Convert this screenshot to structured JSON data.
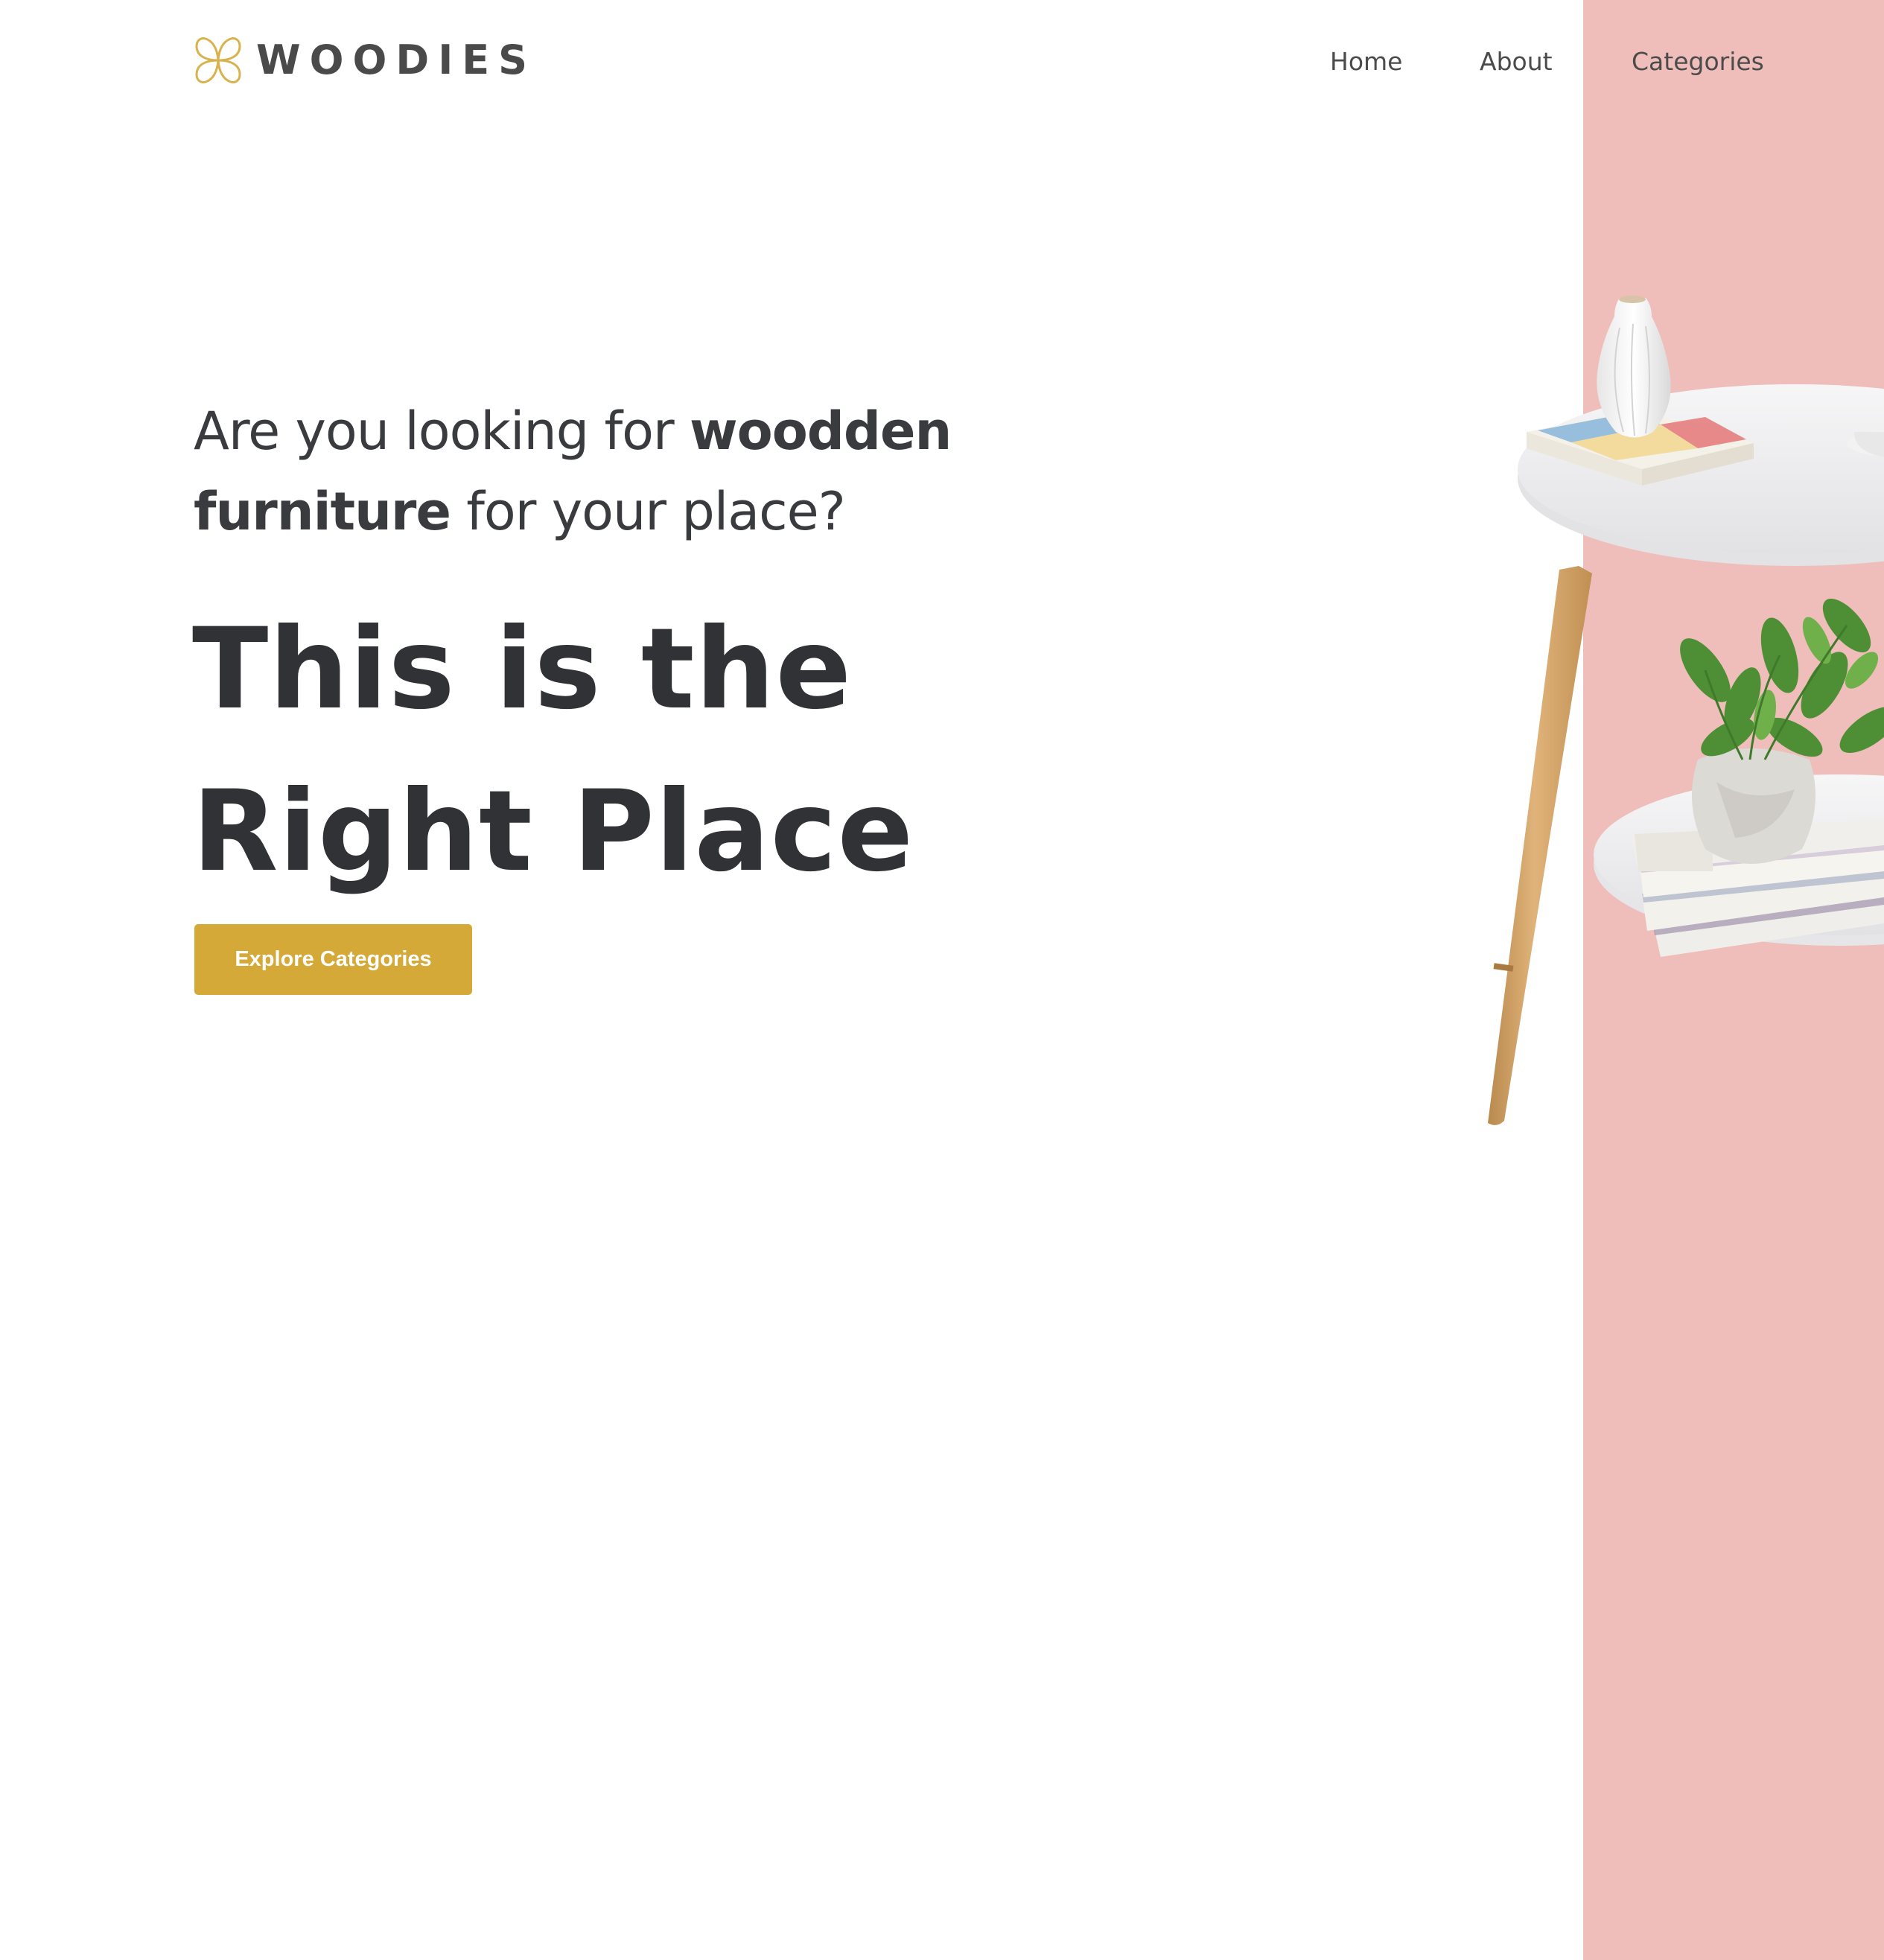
{
  "brand": {
    "name": "WOODIES",
    "logo_icon": "four-petal-flower-icon",
    "accent_color": "#d4a937"
  },
  "nav": {
    "items": [
      {
        "label": "Home"
      },
      {
        "label": "About"
      },
      {
        "label": "Categories"
      }
    ]
  },
  "hero": {
    "subtitle_start": "Are you looking for ",
    "subtitle_bold_1": "woodden",
    "subtitle_bold_2": "furniture",
    "subtitle_end": " for your place?",
    "title_line_1": "This is the",
    "title_line_2": "Right Place",
    "cta_label": "Explore Categories",
    "cta_color": "#d4a937"
  },
  "side_panel": {
    "color": "#efbebb"
  },
  "illustration": {
    "subject": "round white two-tier side table with wooden leg, vase, books and potted plant"
  }
}
